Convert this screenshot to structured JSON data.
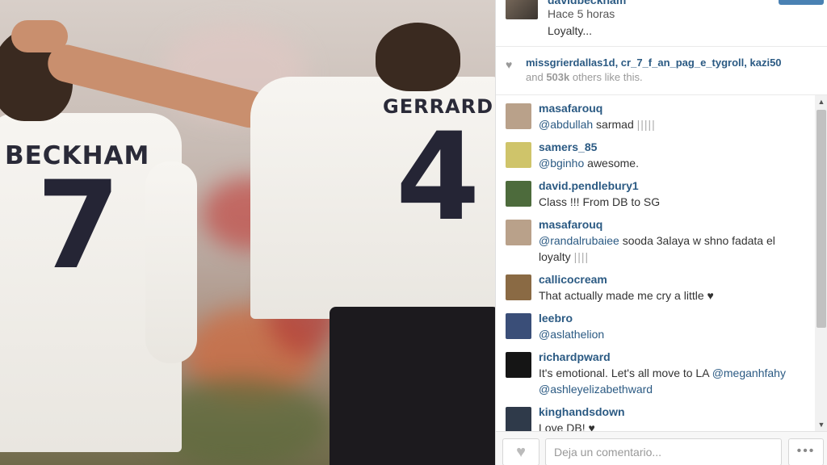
{
  "post": {
    "username": "davidbeckham",
    "time": "Hace 5 horas",
    "caption": "Loyalty..."
  },
  "photo": {
    "left_name": "BECKHAM",
    "left_number": "7",
    "right_name": "GERRARD",
    "right_number": "4"
  },
  "likes": {
    "user1": "missgrierdallas1d",
    "user2": "cr_7_f_an_pag_e_tygroll",
    "user3": "kazi50",
    "sep": ", ",
    "and": "and",
    "count": "503k",
    "others": "others like this."
  },
  "comments": [
    {
      "user": "masafarouq",
      "mention": "@abdullah",
      "text": " sarmad ",
      "bars": "|||||",
      "avatar": "#b9a18a"
    },
    {
      "user": "samers_85",
      "mention": "@bginho",
      "text": " awesome.",
      "bars": "",
      "avatar": "#cfc46a"
    },
    {
      "user": "david.pendlebury1",
      "mention": "",
      "text": "Class !!! From DB to SG",
      "bars": "",
      "avatar": "#4d6b3c"
    },
    {
      "user": "masafarouq",
      "mention": "@randalrubaiee",
      "text": " sooda 3alaya w shno fadata el loyalty ",
      "bars": "||||",
      "avatar": "#b9a18a"
    },
    {
      "user": "callicocream",
      "mention": "",
      "text": "That actually made me cry a little ♥",
      "bars": "",
      "avatar": "#8a6a44"
    },
    {
      "user": "leebro",
      "mention": "@aslathelion",
      "text": "",
      "bars": "",
      "avatar": "#3a4e78"
    },
    {
      "user": "richardpward",
      "mention": "",
      "text": "It's emotional. Let's all move to LA ",
      "mention2": "@meganhfahy",
      "mention3": "@ashleyelizabethward",
      "bars": "",
      "avatar": "#151515"
    },
    {
      "user": "kinghandsdown",
      "mention": "",
      "text": "Love DB! ♥",
      "bars": "",
      "avatar": "#2f3a4a"
    }
  ],
  "footer": {
    "placeholder": "Deja un comentario..."
  }
}
